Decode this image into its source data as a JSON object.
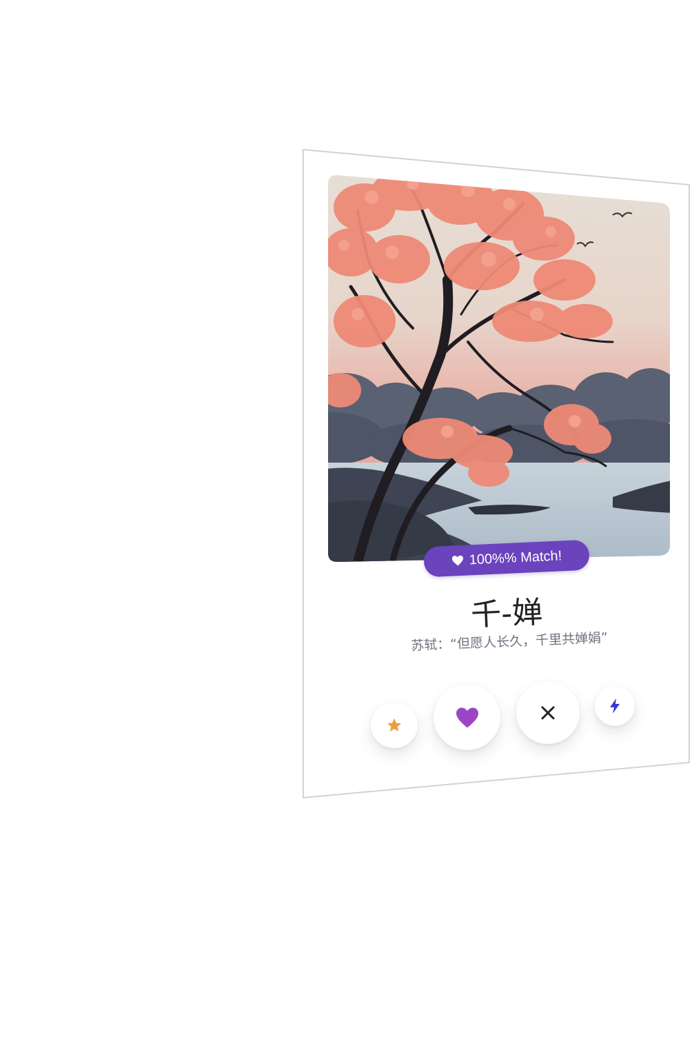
{
  "profile": {
    "match_label": "100%% Match!",
    "name": "千-婵",
    "quote": "苏轼：“但愿人长久，千里共婵娟”"
  },
  "actions": [
    {
      "id": "super-like",
      "icon": "star-icon",
      "color": "#e9a23b"
    },
    {
      "id": "like",
      "icon": "heart-icon",
      "color": "#9c45c4"
    },
    {
      "id": "nope",
      "icon": "close-icon",
      "color": "#222222"
    },
    {
      "id": "boost",
      "icon": "lightning-icon",
      "color": "#3b36d6"
    }
  ],
  "colors": {
    "badge": "#6a43bd",
    "blossom": "#ee8a76",
    "sky_top": "#e5dfd6",
    "sky_bottom": "#e8a9a0",
    "hills": "#4a5161",
    "water": "#b9c6d1"
  }
}
